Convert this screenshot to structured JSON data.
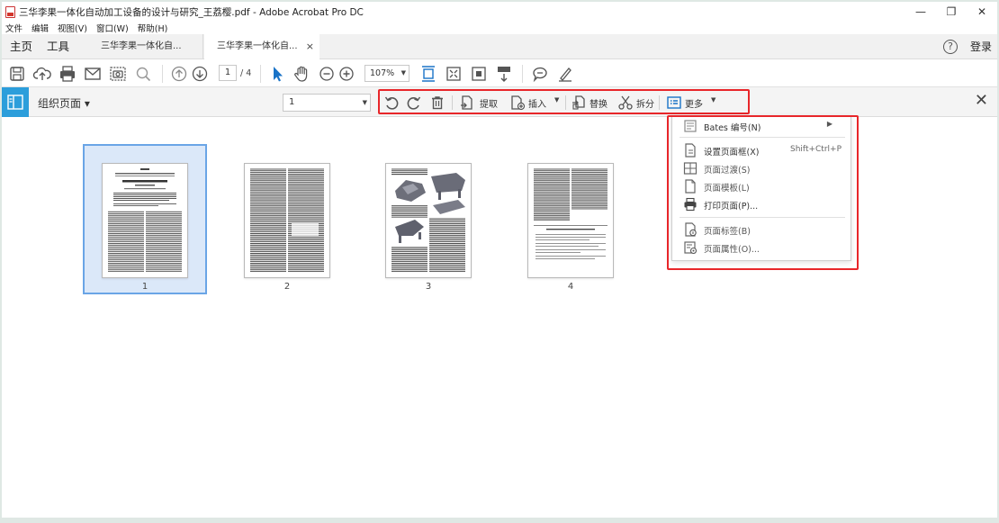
{
  "window": {
    "title": "三华李果一体化自动加工设备的设计与研究_王荔樱.pdf - Adobe Acrobat Pro DC",
    "minimize": "—",
    "restore": "❐",
    "close": "✕"
  },
  "menu": [
    "文件",
    "编辑",
    "视图(V)",
    "窗口(W)",
    "帮助(H)"
  ],
  "tabs": {
    "home": "主页",
    "tools": "工具",
    "doc_tab_1": "三华李果一体化自...",
    "doc_tab_2": "三华李果一体化自...",
    "close_glyph": "×",
    "help_glyph": "?",
    "login": "登录"
  },
  "toolbar": {
    "current_page": "1",
    "total_pages": "/ 4",
    "zoom": "107%"
  },
  "organize": {
    "label": "组织页面 ▾",
    "page_select": "1",
    "tools": {
      "extract": "提取",
      "insert": "插入",
      "replace": "替换",
      "split": "拆分",
      "more": "更多"
    },
    "close_glyph": "✕"
  },
  "pages": [
    {
      "label": "1",
      "selected": true
    },
    {
      "label": "2",
      "selected": false
    },
    {
      "label": "3",
      "selected": false
    },
    {
      "label": "4",
      "selected": false
    }
  ],
  "more_menu": {
    "bates": "Bates 编号(N)",
    "set_page_box": "设置页面框(X)",
    "set_page_box_shortcut": "Shift+Ctrl+P",
    "page_transition": "页面过渡(S)",
    "page_template": "页面模板(L)",
    "print_page": "打印页面(P)...",
    "page_label": "页面标签(B)",
    "page_properties": "页面属性(O)..."
  },
  "colors": {
    "accent_blue": "#2c9edb",
    "highlight_red": "#e8262a",
    "selection_blue": "#6aa5e6"
  }
}
